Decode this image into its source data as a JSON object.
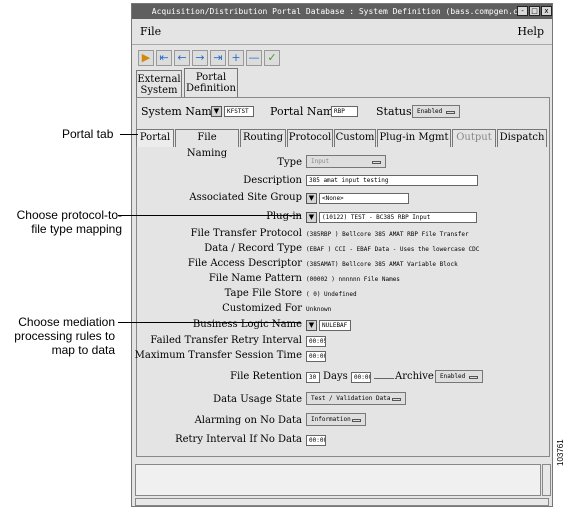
{
  "window": {
    "title": "Acquisition/Distribution Portal Database : System Definition (bass.compgen.com)",
    "buttons": [
      "-",
      "□",
      "x"
    ]
  },
  "menu": {
    "file": "File",
    "help": "Help"
  },
  "toolbar": {
    "icons": [
      "insert-icon",
      "first-icon",
      "prev-icon",
      "next-icon",
      "last-icon",
      "add-icon",
      "remove-icon",
      "check-icon"
    ]
  },
  "outer_tabs": [
    {
      "line1": "External",
      "line2": "System"
    },
    {
      "line1": "Portal",
      "line2": "Definition"
    }
  ],
  "header": {
    "system_name_label": "System Name",
    "system_name_value": "KFSTST",
    "portal_name_label": "Portal Name",
    "portal_name_value": "RBP",
    "status_label": "Status",
    "status_value": "Enabled"
  },
  "inner_tabs": [
    "Portal",
    "File Naming",
    "Routing",
    "Protocol",
    "Custom",
    "Plug-in Mgmt",
    "Output",
    "Dispatch"
  ],
  "form": {
    "type_label": "Type",
    "type_value": "Input",
    "description_label": "Description",
    "description_value": "385 amat input testing",
    "site_group_label": "Associated Site Group",
    "site_group_value": "<None>",
    "plugin_label": "Plug-in",
    "plugin_value": "(10122) TEST - BC385 RBP Input",
    "ftp_label": "File Transfer Protocol",
    "ftp_value": "(385RBP ) Bellcore 385 AMAT RBP File Transfer",
    "drt_label": "Data / Record Type",
    "drt_value": "(EBAF   ) CCI - EBAF Data - Uses the lowercase CDC",
    "fad_label": "File Access Descriptor",
    "fad_value": "(385AMAT) Bellcore 385 AMAT Variable Block",
    "fnp_label": "File Name Pattern",
    "fnp_value": "(00002  ) nnnnnn File Names",
    "tfs_label": "Tape File Store",
    "tfs_value": "(        0) Undefined",
    "cf_label": "Customized For",
    "cf_value": "Unknown",
    "bln_label": "Business Logic Name",
    "bln_value": "NULEBAF",
    "ftri_label": "Failed Transfer Retry Interval",
    "ftri_value": "00:05",
    "mtst_label": "Maximum Transfer Session Time",
    "mtst_value": "00:00",
    "retention_label": "File Retention",
    "retention_days_value": "30",
    "days_label": "Days",
    "retention_time_value": "00:00",
    "archive_label": "Archive",
    "archive_value": "Enabled",
    "dus_label": "Data Usage State",
    "dus_value": "Test / Validation Data",
    "and_label": "Alarming on No Data",
    "and_value": "Information",
    "rind_label": "Retry Interval If No Data",
    "rind_value": "00:00"
  },
  "callouts": {
    "portal_tab": "Portal tab",
    "protocol_line1": "Choose protocol-to-",
    "protocol_line2": "file type mapping",
    "mediation_line1": "Choose mediation",
    "mediation_line2": "processing rules to",
    "mediation_line3": "map to data"
  },
  "figure_id": "103761"
}
